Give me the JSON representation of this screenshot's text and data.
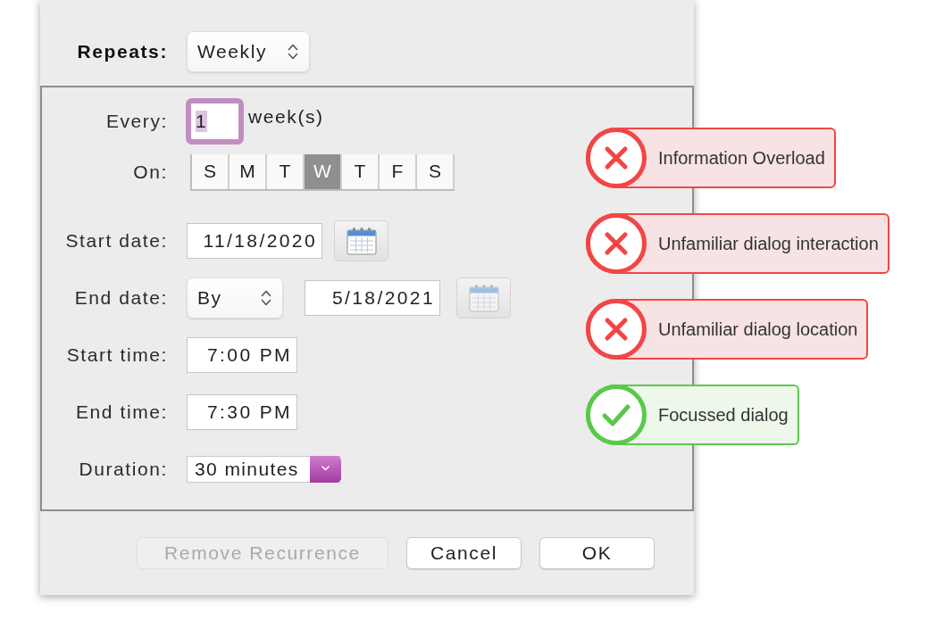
{
  "dialog": {
    "repeats": {
      "label": "Repeats:",
      "value": "Weekly"
    },
    "rows": [
      {
        "kind": "number",
        "label": "Every:",
        "value": "1",
        "unit": "week(s)",
        "focused": true
      },
      {
        "kind": "days",
        "label": "On:",
        "days": [
          {
            "label": "S",
            "selected": false
          },
          {
            "label": "M",
            "selected": false
          },
          {
            "label": "T",
            "selected": false
          },
          {
            "label": "W",
            "selected": true
          },
          {
            "label": "T",
            "selected": false
          },
          {
            "label": "F",
            "selected": false
          },
          {
            "label": "S",
            "selected": false
          }
        ]
      },
      {
        "kind": "date",
        "label": "Start date:",
        "value": "11/18/2020",
        "calendar_disabled": false
      },
      {
        "kind": "date",
        "label": "End date:",
        "mode": "By",
        "value": "5/18/2021",
        "calendar_disabled": true
      },
      {
        "kind": "time",
        "label": "Start time:",
        "value": "7:00 PM"
      },
      {
        "kind": "time",
        "label": "End time:",
        "value": "7:30 PM"
      },
      {
        "kind": "popup",
        "label": "Duration:",
        "value": "30 minutes"
      }
    ],
    "buttons": [
      {
        "label": "Remove Recurrence",
        "disabled": true
      },
      {
        "label": "Cancel",
        "disabled": false
      },
      {
        "label": "OK",
        "disabled": false
      }
    ]
  },
  "annotations": [
    {
      "kind": "fail",
      "text": "Information Overload"
    },
    {
      "kind": "fail",
      "text": "Unfamiliar dialog interaction"
    },
    {
      "kind": "fail",
      "text": "Unfamiliar dialog location"
    },
    {
      "kind": "pass",
      "text": "Focussed dialog"
    }
  ]
}
